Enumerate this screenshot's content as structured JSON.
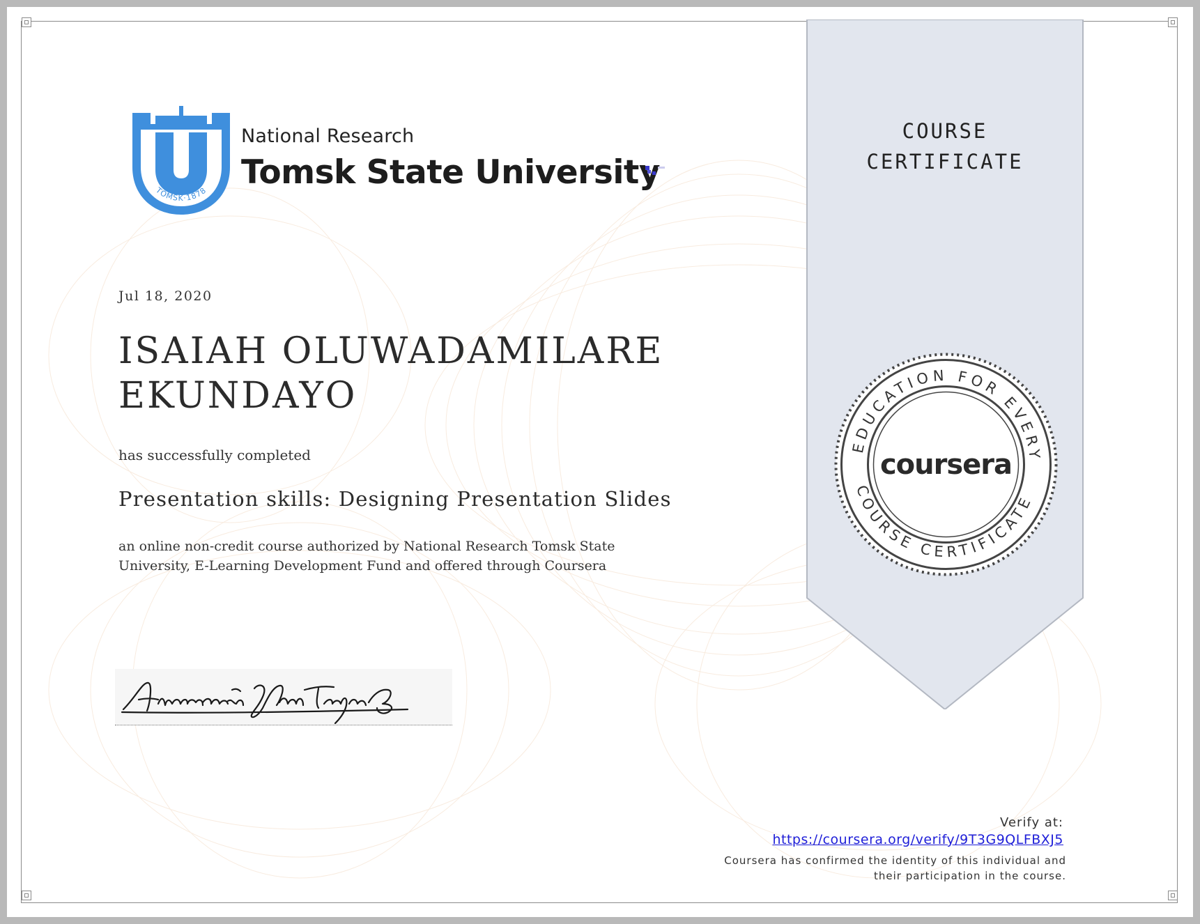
{
  "institution": {
    "line1": "National Research",
    "line2": "Tomsk State University",
    "seal_text": "TOMSK·1878",
    "seal_letter": "U",
    "brand_color": "#3f8fdd"
  },
  "certificate": {
    "date": "Jul 18, 2020",
    "recipient_line1": "ISAIAH OLUWADAMILARE",
    "recipient_line2": "EKUNDAYO",
    "completed_text": "has successfully completed",
    "course_title": "Presentation skills: Designing Presentation Slides",
    "description": "an online non-credit course authorized by National Research Tomsk State University, E-Learning Development Fund and offered through Coursera",
    "signature_text": "Алексей Кантеев"
  },
  "ribbon": {
    "line1": "COURSE",
    "line2": "CERTIFICATE",
    "color": "#e2e6ee"
  },
  "seal": {
    "top_arc": "EDUCATION FOR EVERYONE",
    "bottom_arc": "COURSE CERTIFICATE",
    "brand": "coursera"
  },
  "verify": {
    "label": "Verify at:",
    "url": "https://coursera.org/verify/9T3G9QLFBXJ5",
    "confirm_line1": "Coursera has confirmed the identity of this individual and",
    "confirm_line2": "their participation in the course."
  }
}
